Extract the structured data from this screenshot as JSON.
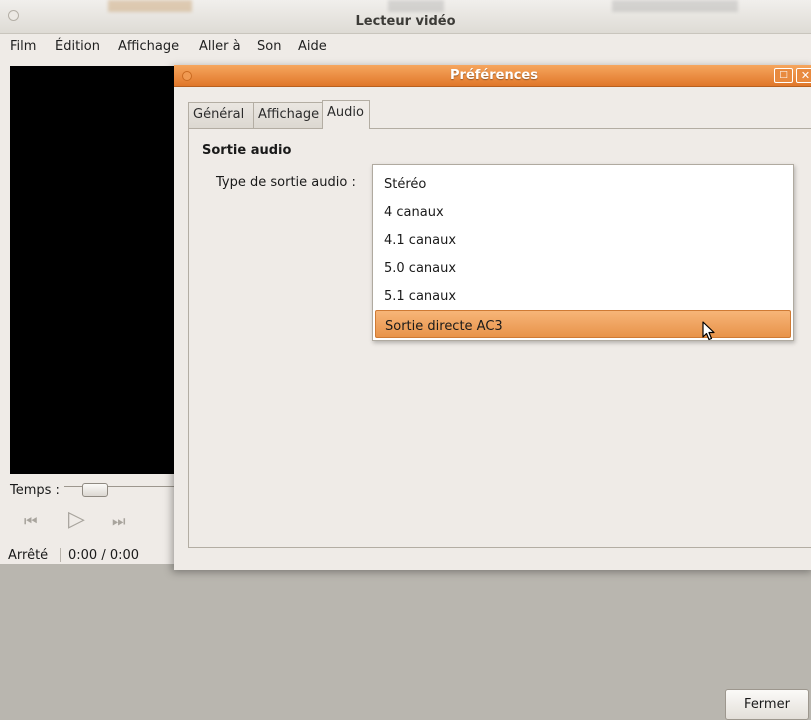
{
  "main_window": {
    "title": "Lecteur vidéo",
    "menu": [
      "Film",
      "Édition",
      "Affichage",
      "Aller à",
      "Son",
      "Aide"
    ],
    "time_label": "Temps :",
    "status": {
      "state": "Arrêté",
      "time": "0:00 / 0:00"
    },
    "controls": {
      "previous": "⏮",
      "play": "▷",
      "next": "⏭"
    }
  },
  "preferences": {
    "title": "Préférences",
    "window_buttons": {
      "maximize": "□",
      "close": "✕"
    },
    "tabs": [
      "Général",
      "Affichage",
      "Audio"
    ],
    "active_tab": "Audio",
    "section_title": "Sortie audio",
    "audio_output_label": "Type de sortie audio :",
    "audio_options": [
      "Stéréo",
      "4 canaux",
      "4.1 canaux",
      "5.0 canaux",
      "5.1 canaux",
      "Sortie directe AC3"
    ],
    "selected_option": "Sortie directe AC3",
    "close_button": "Fermer"
  },
  "colors": {
    "accent": "#e8934a",
    "titlebar_orange": "#e0772a",
    "window_bg": "#efebe7"
  }
}
